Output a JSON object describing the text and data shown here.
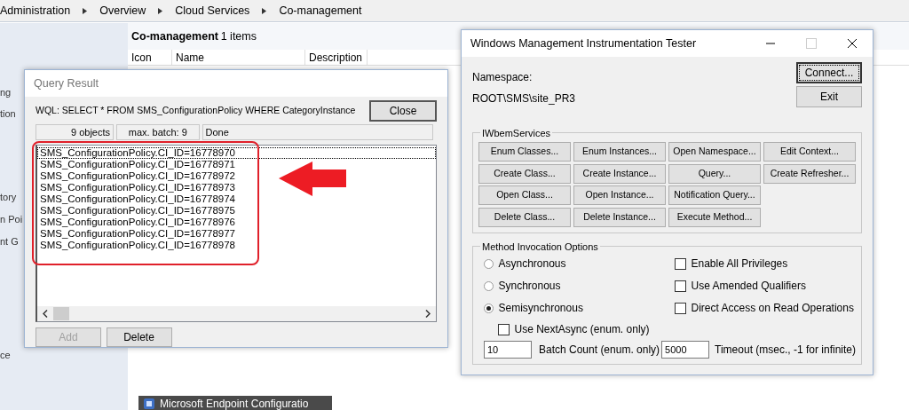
{
  "background": {
    "breadcrumb": [
      "Administration",
      "Overview",
      "Cloud Services",
      "Co-management"
    ],
    "sidebar_fragments": [
      "ng",
      "tion",
      "tory",
      "n Poi",
      "nt G",
      "ce"
    ],
    "list_title": "Co-management",
    "item_count": "1 items",
    "columns": [
      "Icon",
      "Name",
      "Description"
    ],
    "taskbar_tooltip": "Microsoft Endpoint Configuratio"
  },
  "query_result": {
    "title": "Query Result",
    "wql": "WQL: SELECT * FROM SMS_ConfigurationPolicy  WHERE CategoryInstance",
    "close_button": "Close",
    "status": [
      "9 objects",
      "max. batch: 9",
      "Done"
    ],
    "results": [
      {
        "text": "SMS_ConfigurationPolicy.CI_ID=16778970",
        "selected": true
      },
      {
        "text": "SMS_ConfigurationPolicy.CI_ID=16778971",
        "selected": false
      },
      {
        "text": "SMS_ConfigurationPolicy.CI_ID=16778972",
        "selected": false
      },
      {
        "text": "SMS_ConfigurationPolicy.CI_ID=16778973",
        "selected": false
      },
      {
        "text": "SMS_ConfigurationPolicy.CI_ID=16778974",
        "selected": false
      },
      {
        "text": "SMS_ConfigurationPolicy.CI_ID=16778975",
        "selected": false
      },
      {
        "text": "SMS_ConfigurationPolicy.CI_ID=16778976",
        "selected": false
      },
      {
        "text": "SMS_ConfigurationPolicy.CI_ID=16778977",
        "selected": false
      },
      {
        "text": "SMS_ConfigurationPolicy.CI_ID=16778978",
        "selected": false
      }
    ],
    "buttons": [
      {
        "label": "Add",
        "disabled": true
      },
      {
        "label": "Delete",
        "disabled": false
      }
    ]
  },
  "wmi_tester": {
    "title": "Windows Management Instrumentation Tester",
    "namespace_label": "Namespace:",
    "namespace": "ROOT\\SMS\\site_PR3",
    "buttons": [
      {
        "label": "Connect...",
        "focused": true
      },
      {
        "label": "Exit",
        "focused": false
      }
    ],
    "services_group": "IWbemServices",
    "service_columns": [
      [
        "Enum Classes...",
        "Create Class...",
        "Open Class...",
        "Delete Class..."
      ],
      [
        "Enum Instances...",
        "Create Instance...",
        "Open Instance...",
        "Delete Instance..."
      ],
      [
        "Open Namespace...",
        "Query...",
        "Notification Query...",
        "Execute Method..."
      ],
      [
        "Edit Context...",
        "Create Refresher..."
      ]
    ],
    "options_group": "Method Invocation Options",
    "modes": [
      {
        "label": "Asynchronous",
        "selected": false
      },
      {
        "label": "Synchronous",
        "selected": false
      },
      {
        "label": "Semisynchronous",
        "selected": true
      }
    ],
    "flags": [
      {
        "label": "Enable All Privileges",
        "checked": false
      },
      {
        "label": "Use Amended Qualifiers",
        "checked": false
      },
      {
        "label": "Direct Access on Read Operations",
        "checked": false
      }
    ],
    "next_async": {
      "label": "Use NextAsync (enum. only)",
      "checked": false
    },
    "batch": {
      "value": "10",
      "label": "Batch Count (enum. only)"
    },
    "timeout": {
      "value": "5000",
      "label": "Timeout (msec., -1 for infinite)"
    }
  }
}
